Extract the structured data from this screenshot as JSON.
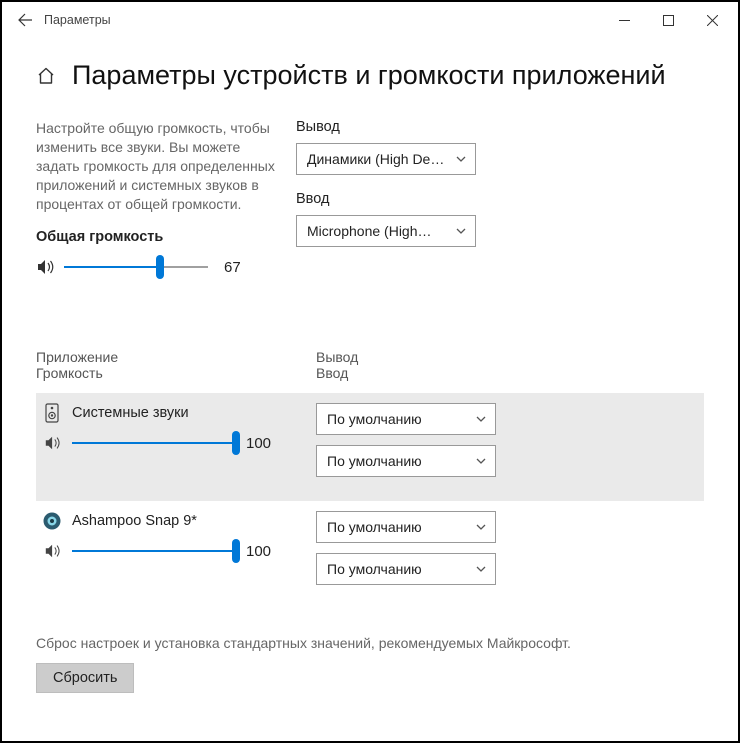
{
  "titlebar": {
    "title": "Параметры"
  },
  "page": {
    "heading": "Параметры устройств и громкости приложений",
    "description": "Настройте общую громкость, чтобы изменить все звуки. Вы можете задать громкость для определенных приложений и системных звуков в процентах от общей громкости.",
    "master_label": "Общая громкость",
    "master_volume": 67,
    "output_label": "Вывод",
    "output_value": "Динамики (High De…",
    "input_label": "Ввод",
    "input_value": "Microphone (High…",
    "apps_header": {
      "app": "Приложение",
      "volume": "Громкость",
      "output": "Вывод",
      "input": "Ввод"
    },
    "apps": [
      {
        "name": "Системные звуки",
        "volume": 100,
        "output": "По умолчанию",
        "input": "По умолчанию",
        "selected": true,
        "icon": "speaker-device"
      },
      {
        "name": "Ashampoo Snap 9*",
        "volume": 100,
        "output": "По умолчанию",
        "input": "По умолчанию",
        "selected": false,
        "icon": "app-circle"
      }
    ],
    "reset_text": "Сброс настроек и установка стандартных значений, рекомендуемых Майкрософт.",
    "reset_button": "Сбросить"
  },
  "colors": {
    "accent": "#0078d7"
  }
}
